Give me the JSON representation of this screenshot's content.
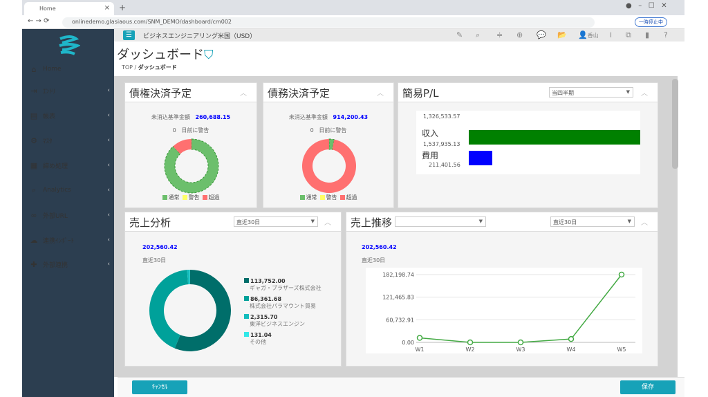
{
  "browser": {
    "tab_title": "Home",
    "new_tab": "+",
    "url": "onlinedemo.glasiaous.com/SNM_DEMO/dashboard/cm002",
    "paused_label": "一時停止中"
  },
  "app": {
    "company": "ビジネスエンジニアリング米国（USD）",
    "user": "香山",
    "page_title": "ダッシュボード",
    "breadcrumb": [
      "TOP",
      "ダッシュボード"
    ]
  },
  "sidebar": {
    "items": [
      {
        "label": "Home",
        "icon": "home-icon"
      },
      {
        "label": "ｴﾝﾄﾘ",
        "icon": "entry-icon"
      },
      {
        "label": "帳表",
        "icon": "document-icon"
      },
      {
        "label": "ﾏｽﾀ",
        "icon": "gear-icon"
      },
      {
        "label": "締め処理",
        "icon": "calendar-icon"
      },
      {
        "label": "Analytics",
        "icon": "search-icon"
      },
      {
        "label": "外部URL",
        "icon": "link-icon"
      },
      {
        "label": "連携ｲﾝﾎﾟｰﾄ",
        "icon": "cloud-upload-icon"
      },
      {
        "label": "外部連携",
        "icon": "puzzle-icon"
      }
    ]
  },
  "receivable": {
    "title": "債権決済予定",
    "amount_label": "未消込基準金額",
    "amount": "260,688.15",
    "warn_days": "0",
    "warn_label": "日前に警告",
    "legend": [
      "通常",
      "警告",
      "超過"
    ],
    "slices": [
      88,
      0,
      12
    ]
  },
  "payable": {
    "title": "債務決済予定",
    "amount_label": "未消込基準金額",
    "amount": "914,200.43",
    "warn_days": "0",
    "warn_label": "日前に警告",
    "legend": [
      "通常",
      "警告",
      "超過"
    ],
    "slices": [
      3,
      0,
      97
    ]
  },
  "pl": {
    "title": "簡易P/L",
    "period": "当四半期",
    "top_value": "1,326,533.57",
    "rows": [
      {
        "label": "収入",
        "value": "1,537,935.13",
        "amount": 1537935.13,
        "color": "#008000"
      },
      {
        "label": "費用",
        "value": "211,401.56",
        "amount": 211401.56,
        "color": "#0000ff"
      }
    ]
  },
  "sales_analysis": {
    "title": "売上分析",
    "period": "直近30日",
    "total": "202,560.42",
    "sub": "直近30日",
    "items": [
      {
        "value": "113,752.00",
        "name": "ギャガ・ブラザーズ株式会社",
        "amount": 113752.0,
        "color": "#006e6a"
      },
      {
        "value": "86,361.68",
        "name": "株式会社パラマウント貿易",
        "amount": 86361.68,
        "color": "#00a19a"
      },
      {
        "value": "2,315.70",
        "name": "東洋ビジネスエンジン",
        "amount": 2315.7,
        "color": "#14bdbd"
      },
      {
        "value": "131.04",
        "name": "その他",
        "amount": 131.04,
        "color": "#33e8e8"
      }
    ]
  },
  "sales_trend": {
    "title": "売上推移",
    "filter": "",
    "period": "直近30日",
    "total": "202,560.42",
    "sub": "直近30日"
  },
  "chart_data": {
    "type": "line",
    "categories": [
      "W1",
      "W2",
      "W3",
      "W4",
      "W5"
    ],
    "values": [
      12000,
      0,
      0,
      9000,
      182198.74
    ],
    "y_ticks": [
      "182,198.74",
      "121,465.83",
      "60,732.91",
      "0.00"
    ],
    "ylim": [
      0,
      182198.74
    ],
    "color": "#44aa44"
  },
  "footer": {
    "cancel": "ｷｬﾝｾﾙ",
    "save": "保存"
  }
}
